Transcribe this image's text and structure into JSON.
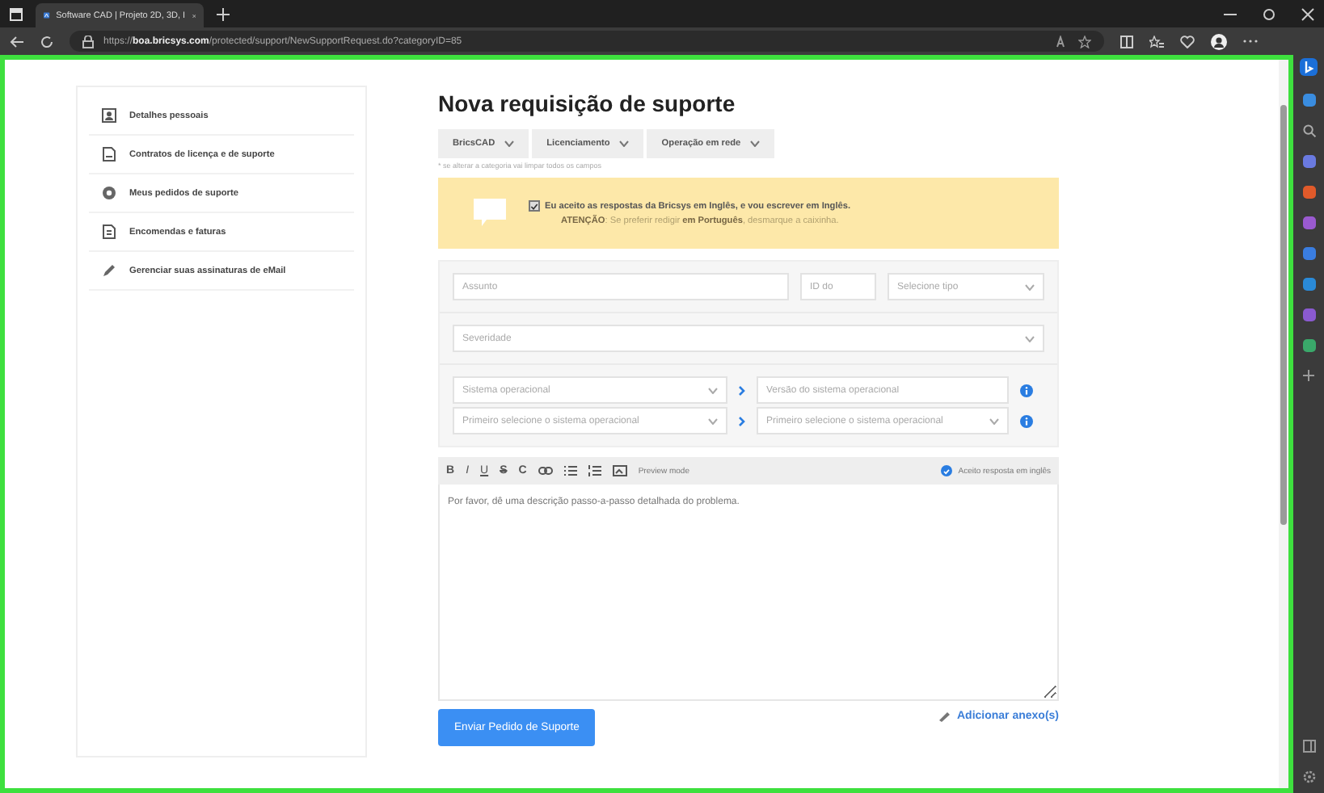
{
  "browser": {
    "tab_title": "Software CAD | Projeto 2D, 3D, I",
    "url": "https://**boa.bricsys.com**/protected/support/NewSupportRequest.do?categoryID=85"
  },
  "sidebar": {
    "items": [
      {
        "label": "Detalhes pessoais",
        "kind": "person"
      },
      {
        "label": "Contratos de licença e de suporte",
        "kind": "document"
      },
      {
        "label": "Meus pedidos de suporte",
        "kind": "lifebuoy"
      },
      {
        "label": "Encomendas e faturas",
        "kind": "invoice"
      },
      {
        "label": "Gerenciar suas assinaturas de eMail",
        "kind": "pen"
      }
    ]
  },
  "page": {
    "title": "Nova requisição de suporte",
    "categories": [
      "BricsCAD",
      "Licenciamento",
      "Operação em rede"
    ],
    "category_note": "* se alterar a categoria vai limpar todos os campos",
    "notice": {
      "checked": true,
      "text": "Eu aceito as respostas da Bricsys em Inglês, e vou escrever em Inglês.",
      "attention": "**ATENÇÃO**: Se preferir redigir **em Português**, desmarque a caixinha."
    },
    "subject": {
      "placeholder": "Assunto"
    },
    "id_field": {
      "placeholder": "ID do"
    },
    "type_select": {
      "placeholder": "Selecione tipo"
    },
    "severity_select": {
      "placeholder": "Severidade"
    },
    "os_rows": [
      {
        "kind": "field",
        "os": {
          "placeholder": "Sistema operacional"
        },
        "version": {
          "placeholder": "Versão do sistema operacional"
        }
      },
      {
        "kind": "select",
        "os": {
          "placeholder": "Primeiro selecione o sistema operacional"
        },
        "version": {
          "placeholder": "Primeiro selecione o sistema operacional"
        }
      }
    ],
    "editor": {
      "tools": [
        {
          "kind": "text",
          "label": "B"
        },
        {
          "kind": "text",
          "label": "I"
        },
        {
          "kind": "text",
          "label": "U"
        },
        {
          "kind": "text",
          "label": "S"
        },
        {
          "kind": "text",
          "label": "C"
        },
        {
          "kind": "link"
        },
        {
          "kind": "bullets"
        },
        {
          "kind": "numbers"
        },
        {
          "kind": "image"
        }
      ],
      "preview": "Preview mode",
      "accept": {
        "checked": true,
        "label": "Aceito resposta em inglês"
      },
      "placeholder": "Por favor, dê uma descrição passo-a-passo detalhada do problema."
    },
    "submit": "Enviar Pedido de Suporte",
    "attach": "Adicionar anexo(s)"
  }
}
